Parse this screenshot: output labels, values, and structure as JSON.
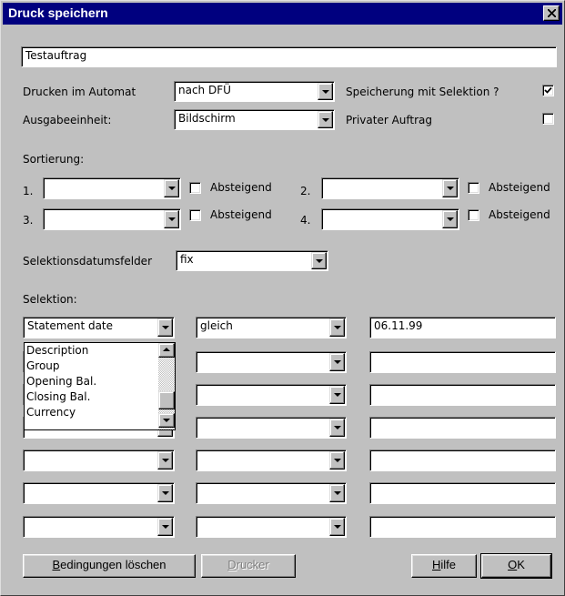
{
  "window": {
    "title": "Druck speichern"
  },
  "name_field": {
    "value": "Testauftrag"
  },
  "drucken_im_automat": {
    "label": "Drucken im Automat",
    "value": "nach DFÜ"
  },
  "ausgabeeinheit": {
    "label": "Ausgabeeinheit:",
    "value": "Bildschirm"
  },
  "speicherung_mit_selektion": {
    "label": "Speicherung mit Selektion ?",
    "checked": true
  },
  "privater_auftrag": {
    "label": "Privater Auftrag",
    "checked": false
  },
  "sortierung": {
    "label": "Sortierung:",
    "rows": [
      {
        "number": "1.",
        "value": "",
        "descending_label": "Absteigend",
        "descending": false
      },
      {
        "number": "2.",
        "value": "",
        "descending_label": "Absteigend",
        "descending": false
      },
      {
        "number": "3.",
        "value": "",
        "descending_label": "Absteigend",
        "descending": false
      },
      {
        "number": "4.",
        "value": "",
        "descending_label": "Absteigend",
        "descending": false
      }
    ]
  },
  "selektionsdatumsfelder": {
    "label": "Selektionsdatumsfelder",
    "value": "fix"
  },
  "selektion": {
    "label": "Selektion:",
    "rows": [
      {
        "field": "Statement date",
        "operator": "gleich",
        "value": "06.11.99"
      },
      {
        "field": "",
        "operator": "",
        "value": ""
      },
      {
        "field": "",
        "operator": "",
        "value": ""
      },
      {
        "field": "",
        "operator": "",
        "value": ""
      },
      {
        "field": "",
        "operator": "",
        "value": ""
      },
      {
        "field": "",
        "operator": "",
        "value": ""
      },
      {
        "field": "",
        "operator": "",
        "value": ""
      }
    ],
    "dropdown_options": [
      "Description",
      "Group",
      "Opening Bal.",
      "Closing Bal.",
      "Currency"
    ]
  },
  "buttons": {
    "clear_conditions": {
      "prefix": "B",
      "rest": "edingungen löschen"
    },
    "printer": {
      "prefix": "D",
      "rest": "rucker"
    },
    "help": {
      "prefix": "H",
      "rest": "ilfe"
    },
    "ok": {
      "prefix": "O",
      "rest": "K"
    }
  },
  "colors": {
    "title_bar": "#00007f",
    "face": "#c0c0c0"
  }
}
